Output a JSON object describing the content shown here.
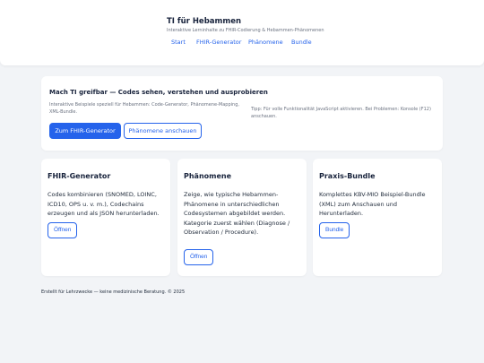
{
  "header": {
    "title": "TI für Hebammen",
    "subtitle": "Interaktive Lerninhalte zu FHIR-Codierung & Hebammen-Phänomenen",
    "nav": [
      "Start",
      "FHIR-Generator",
      "Phänomene",
      "Bundle"
    ]
  },
  "hero": {
    "title": "Mach TI greifbar — Codes sehen, verstehen und ausprobieren",
    "description": "Interaktive Beispiele speziell für Hebammen: Code-Generator, Phänomene-Mapping, XML-Bundle.",
    "tip": "Tipp: Für volle Funktionalität JavaScript aktivieren. Bei Problemen: Konsole (F12) anschauen.",
    "primary_button": "Zum FHIR-Generator",
    "secondary_button": "Phänomene anschauen"
  },
  "cards": [
    {
      "title": "FHIR-Generator",
      "text": "Codes kombinieren (SNOMED, LOINC, ICD10, OPS u. v. m.), Codechains erzeugen und als JSON herunterladen.",
      "button": "Öffnen"
    },
    {
      "title": "Phänomene",
      "text": "Zeige, wie typische Hebammen-Phänomene in unterschiedlichen Codesystemen abgebildet werden. Kategorie zuerst wählen (Diagnose / Observation / Procedure).",
      "button": "Öffnen"
    },
    {
      "title": "Praxis-Bundle",
      "text": "Komplettes KBV-MIO Beispiel-Bundle (XML) zum Anschauen und Herunterladen.",
      "button": "Bundle"
    }
  ],
  "footer": "Erstellt für Lehrzwecke — keine medizinische Beratung. © 2025",
  "colors": {
    "accent": "#2563eb",
    "background": "#f2f4f7",
    "text": "#1f2a3a"
  }
}
